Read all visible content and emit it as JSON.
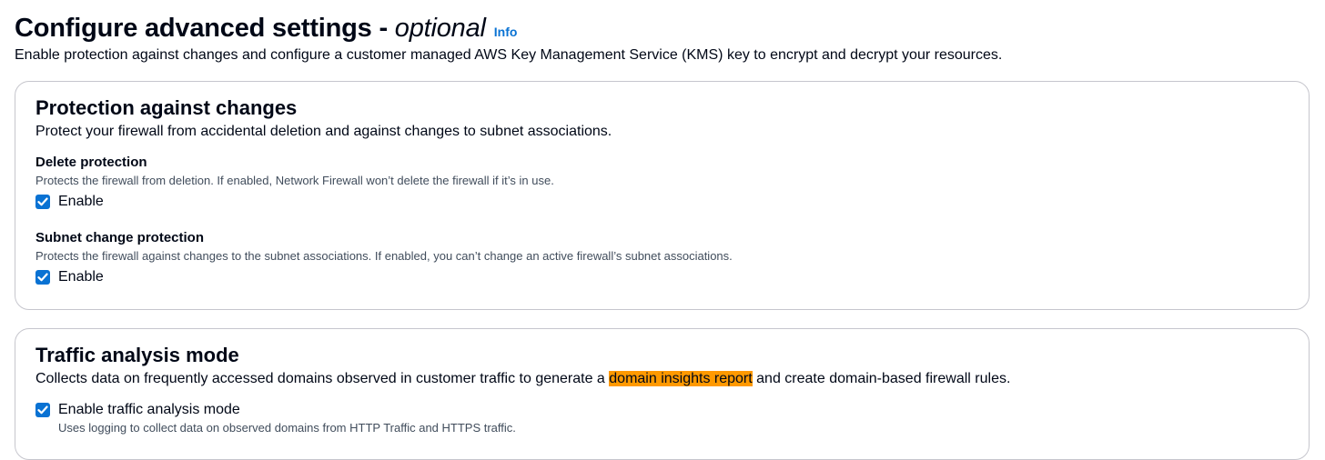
{
  "header": {
    "title": "Configure advanced settings - ",
    "title_optional": "optional",
    "info_link": "Info",
    "description": "Enable protection against changes and configure a customer managed AWS Key Management Service (KMS) key to encrypt and decrypt your resources."
  },
  "protection": {
    "title": "Protection against changes",
    "description": "Protect your firewall from accidental deletion and against changes to subnet associations.",
    "delete_protection": {
      "label": "Delete protection",
      "description": "Protects the firewall from deletion. If enabled, Network Firewall won’t delete the firewall if it’s in use.",
      "checkbox_label": "Enable",
      "checked": true
    },
    "subnet_change_protection": {
      "label": "Subnet change protection",
      "description": "Protects the firewall against changes to the subnet associations. If enabled, you can’t change an active firewall’s subnet associations.",
      "checkbox_label": "Enable",
      "checked": true
    }
  },
  "traffic": {
    "title": "Traffic analysis mode",
    "description_before": "Collects data on frequently accessed domains observed in customer traffic to generate a ",
    "description_highlight": "domain insights report",
    "description_after": " and create domain-based firewall rules.",
    "checkbox_label": "Enable traffic analysis mode",
    "checkbox_description": "Uses logging to collect data on observed domains from HTTP Traffic and HTTPS traffic.",
    "checked": true
  },
  "colors": {
    "accent": "#0972d3",
    "highlight": "#ff9900",
    "border": "#c6c6cd",
    "text": "#000716",
    "secondary_text": "#414d5c"
  },
  "icons": {
    "checkbox_checked": "checkmark-icon"
  }
}
